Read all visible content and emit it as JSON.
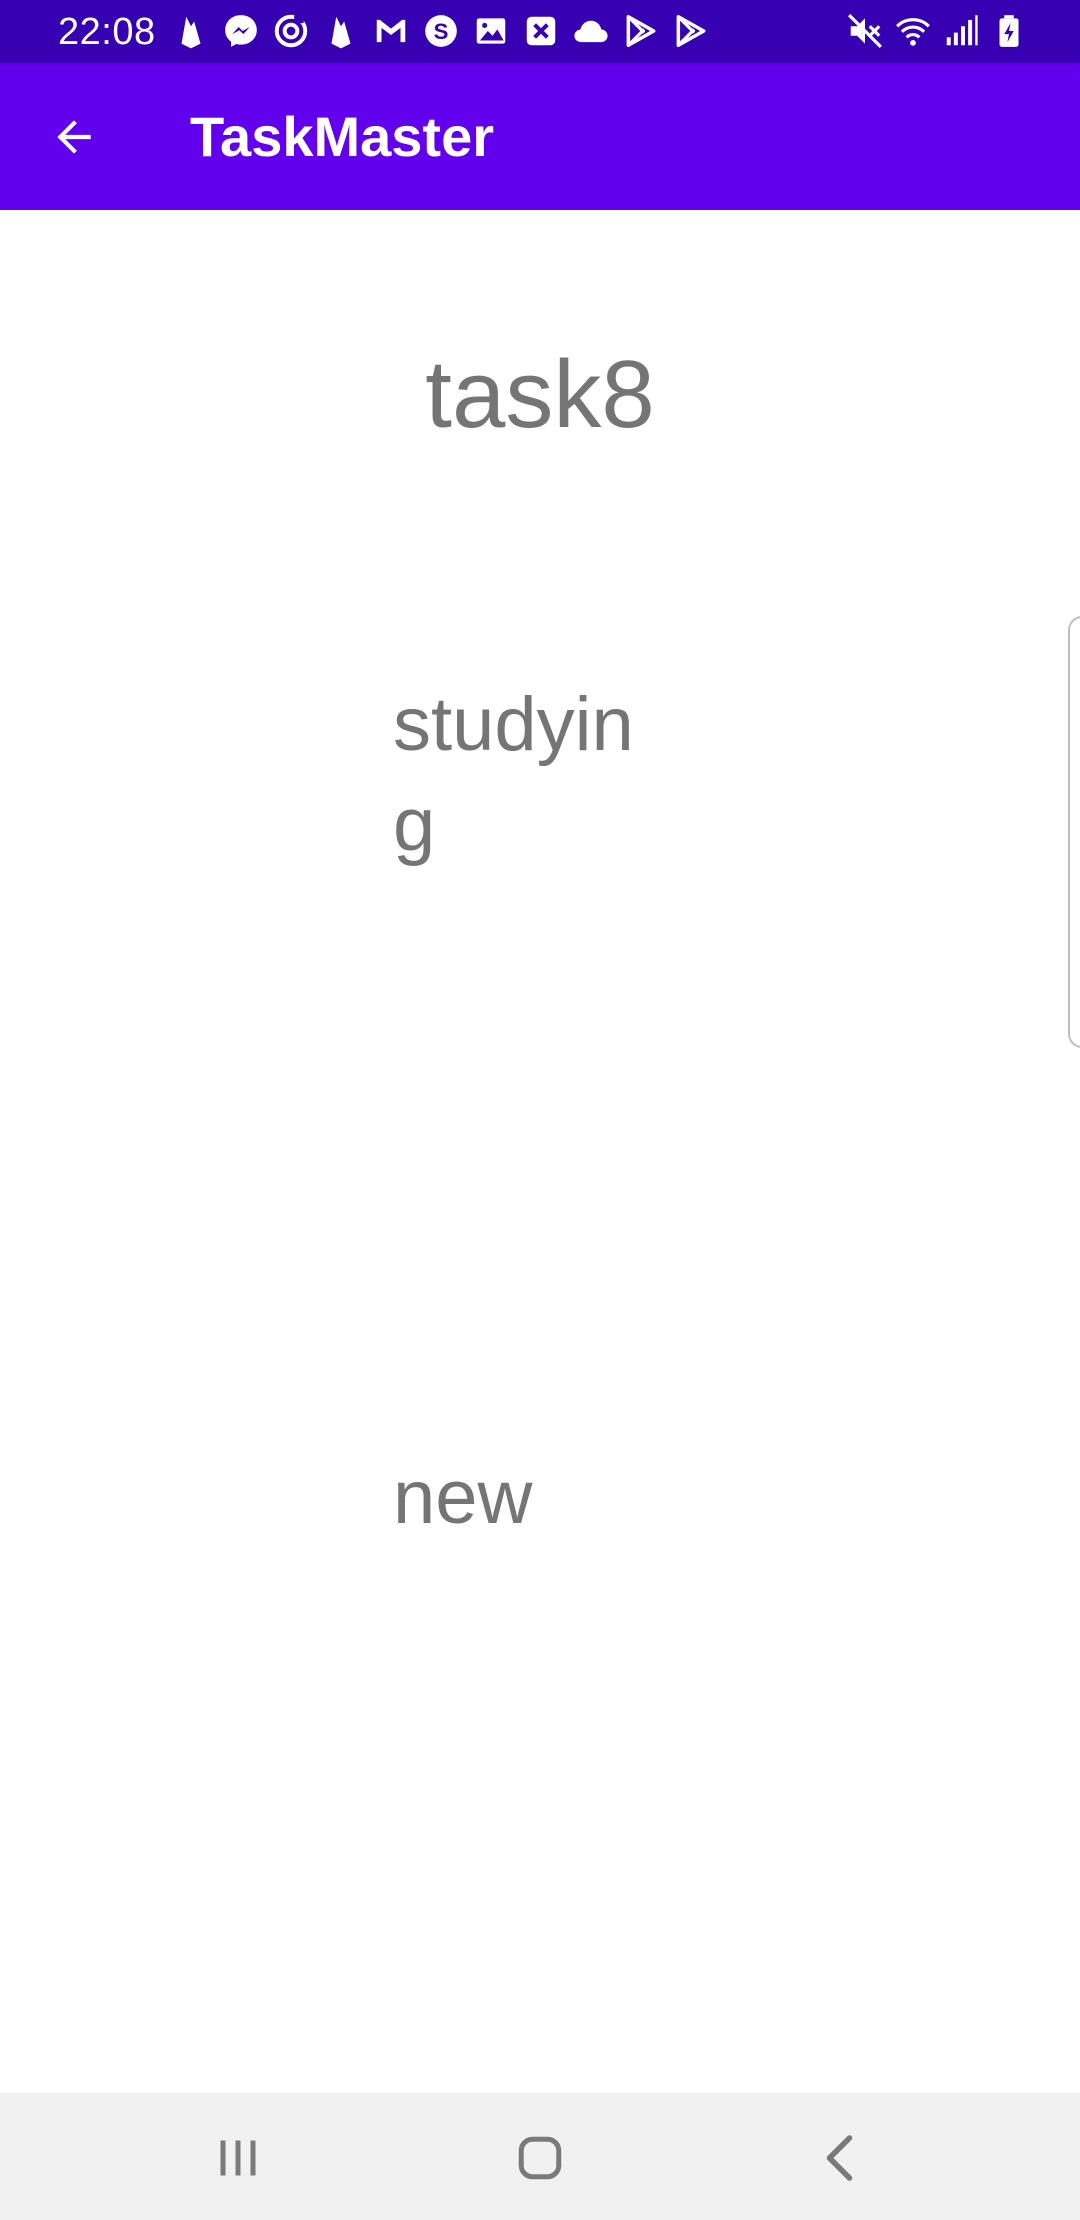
{
  "status_bar": {
    "time": "22:08",
    "notification_icons": [
      "firebase-icon",
      "messenger-icon",
      "sync-icon",
      "firebase-icon",
      "gmail-icon",
      "s-icon",
      "gallery-icon",
      "close-box-icon",
      "cloud-icon",
      "play-store-icon",
      "play-store-icon"
    ],
    "system_icons": [
      "mute-icon",
      "wifi-icon",
      "signal-icon",
      "battery-charging-icon"
    ],
    "background": "#3700b3"
  },
  "app_bar": {
    "title": "TaskMaster",
    "background": "#6200ee"
  },
  "task": {
    "title": "task8",
    "body": "studying",
    "state": "new"
  }
}
